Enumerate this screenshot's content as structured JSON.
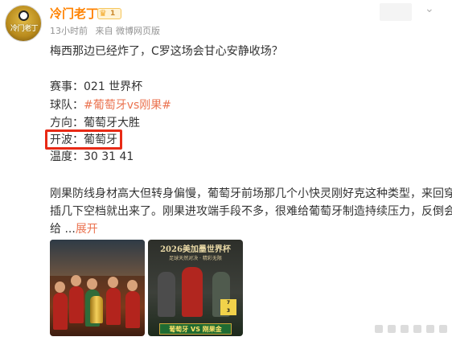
{
  "header": {
    "avatar_text": "冷门老丁",
    "username": "冷门老丁",
    "vip_level": "1",
    "time": "13小时前",
    "source": "来自 微博网页版"
  },
  "post": {
    "intro": "梅西那边已经炸了，C罗这场会甘心安静收场？",
    "match_label": "赛事：",
    "match_value": "021 世界杯",
    "teams_label": "球队：",
    "teams_value": "#葡萄牙vs刚果#",
    "direction_label": "方向：",
    "direction_value": "葡萄牙大胜",
    "kickoff_label": "开波：",
    "kickoff_value": "葡萄牙",
    "temp_label": "温度：",
    "temp_value": "30  31  41",
    "para_line1": "刚果防线身材高大但转身偏慢，葡萄牙前场那几个小快灵刚好克这种类型，来回穿",
    "para_line2": "插几下空档就出来了。刚果进攻端手段不多，很难给葡萄牙制造持续压力，反倒会",
    "para_line3": "给  ...",
    "expand_label": "展开"
  },
  "images": {
    "image2_title": "2026美加墨世界杯",
    "image2_sub": "足球天然对决 · 精彩无限",
    "image2_date_top": "7",
    "image2_date_bottom": "3",
    "image2_tag": "葡萄牙 VS 刚果金"
  },
  "colors": {
    "username": "#ff8200",
    "hashtag": "#eb7350",
    "highlight_box": "#e82a16"
  }
}
